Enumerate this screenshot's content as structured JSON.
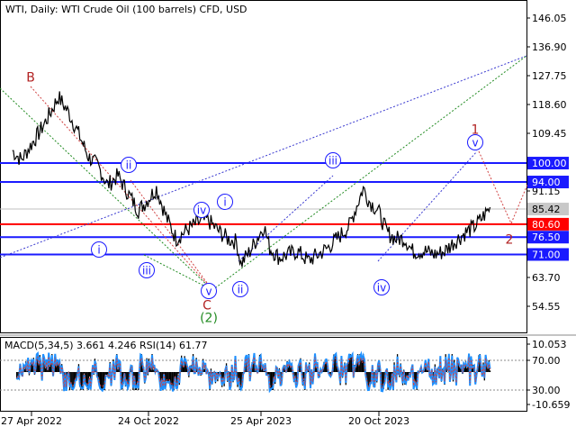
{
  "header": {
    "symbol_line": "WTI, Daily:  WTI Crude Oil (100 barrels) CFD, USD"
  },
  "colors": {
    "accent_blue": "#1a1aff",
    "support_red": "#ff0000",
    "wave_red": "#b22222",
    "wave_green": "#228b22",
    "price_tag_gray": "#c8c8c8",
    "macd_fill": "#000000",
    "rsi_line": "#1e90ff"
  },
  "chart_data": [
    {
      "type": "line",
      "title": "WTI, Daily:  WTI Crude Oil (100 barrels) CFD, USD",
      "x_tick_labels": [
        "27 Apr 2022",
        "24 Oct 2022",
        "25 Apr 2023",
        "20 Oct 2023"
      ],
      "y_tick_labels": [
        "146.05",
        "136.90",
        "127.75",
        "118.60",
        "109.45",
        "100.00",
        "94.00",
        "91.15",
        "85.42",
        "80.60",
        "76.50",
        "71.00",
        "63.70",
        "54.55"
      ],
      "ylim": [
        50,
        150
      ],
      "current_price": 85.42,
      "series": [
        {
          "x": [
            "2022-03-28",
            "2022-04-11",
            "2022-04-27",
            "2022-05-10",
            "2022-05-24",
            "2022-06-08",
            "2022-06-24",
            "2022-07-08",
            "2022-07-25",
            "2022-08-09",
            "2022-08-24",
            "2022-09-09",
            "2022-09-26",
            "2022-10-11",
            "2022-10-24",
            "2022-11-08",
            "2022-11-25",
            "2022-12-09",
            "2022-12-27",
            "2023-01-11",
            "2023-01-27",
            "2023-02-10",
            "2023-02-27",
            "2023-03-13",
            "2023-03-20",
            "2023-04-03",
            "2023-04-25",
            "2023-05-04",
            "2023-05-19",
            "2023-06-02",
            "2023-06-16",
            "2023-07-03",
            "2023-07-19",
            "2023-08-02",
            "2023-08-17",
            "2023-09-05",
            "2023-09-27",
            "2023-10-06",
            "2023-10-20",
            "2023-11-03",
            "2023-11-16",
            "2023-12-01",
            "2023-12-13",
            "2024-01-02",
            "2024-01-17",
            "2024-02-01",
            "2024-02-16",
            "2024-03-05",
            "2024-03-20",
            "2024-04-05",
            "2024-04-12"
          ],
          "values": [
            104,
            101,
            106,
            110,
            115,
            121,
            116,
            110,
            102,
            99,
            93,
            96,
            90,
            85,
            88,
            92,
            82,
            76,
            79,
            81,
            82,
            79,
            76,
            75,
            68,
            72,
            80,
            73,
            70,
            71,
            72,
            69,
            71,
            73,
            76,
            80,
            92,
            88,
            85,
            78,
            76,
            76,
            72,
            72,
            71,
            72,
            75,
            78,
            80,
            84,
            86
          ]
        }
      ],
      "horizontal_levels": [
        {
          "value": 100.0,
          "label": "100.00",
          "color": "#1a1aff"
        },
        {
          "value": 94.0,
          "label": "94.00",
          "color": "#1a1aff"
        },
        {
          "value": 80.6,
          "label": "80.60",
          "color": "#ff0000"
        },
        {
          "value": 76.5,
          "label": "76.50",
          "color": "#1a1aff"
        },
        {
          "value": 71.0,
          "label": "71.00",
          "color": "#1a1aff"
        }
      ],
      "wave_labels": [
        {
          "text": "B",
          "color": "#b22222",
          "circled": false
        },
        {
          "text": "ii",
          "color": "#1a1aff",
          "circled": true
        },
        {
          "text": "i",
          "color": "#1a1aff",
          "circled": true
        },
        {
          "text": "iii",
          "color": "#1a1aff",
          "circled": true
        },
        {
          "text": "iv",
          "color": "#1a1aff",
          "circled": true
        },
        {
          "text": "i",
          "color": "#1a1aff",
          "circled": true
        },
        {
          "text": "v",
          "color": "#1a1aff",
          "circled": true
        },
        {
          "text": "C",
          "color": "#b22222",
          "circled": false
        },
        {
          "text": "(2)",
          "color": "#228b22",
          "circled": false
        },
        {
          "text": "ii",
          "color": "#1a1aff",
          "circled": true
        },
        {
          "text": "iii",
          "color": "#1a1aff",
          "circled": true
        },
        {
          "text": "iv",
          "color": "#1a1aff",
          "circled": true
        },
        {
          "text": "1",
          "color": "#b22222",
          "circled": false
        },
        {
          "text": "v",
          "color": "#1a1aff",
          "circled": true
        },
        {
          "text": "2",
          "color": "#b22222",
          "circled": false
        }
      ],
      "grid": false
    },
    {
      "type": "line",
      "title": "MACD(5,34,5) 3.661 4.246 RSI(14) 61.77",
      "y_tick_labels": [
        "10.053",
        "70.00",
        "30.00",
        "-10.659"
      ],
      "ylim": [
        -10.659,
        10.053
      ],
      "rsi_levels": [
        70,
        30
      ],
      "indicator_values": {
        "macd_main": 3.661,
        "macd_signal": 4.246,
        "rsi": 61.77
      }
    }
  ]
}
